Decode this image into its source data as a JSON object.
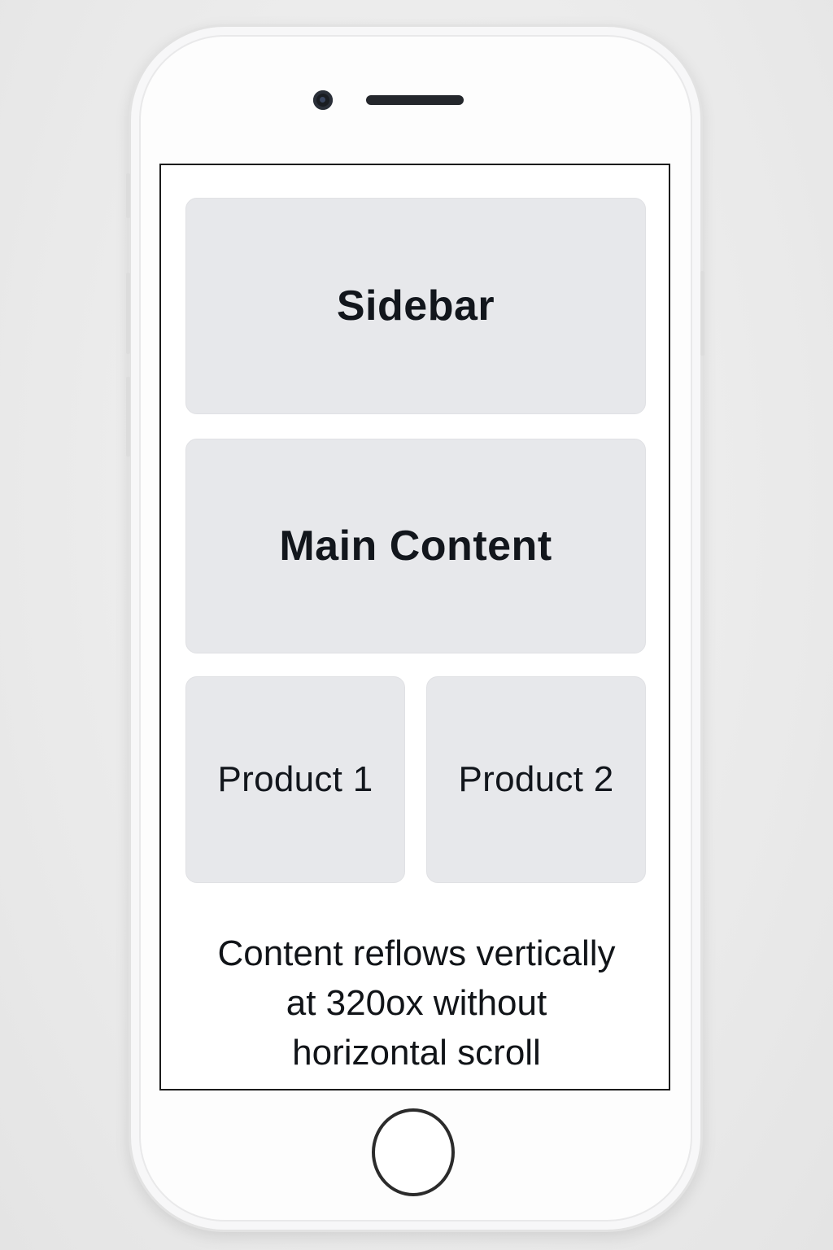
{
  "device": {
    "type": "smartphone",
    "colors": {
      "body": "#fdfdfd",
      "screen_border": "#1c1c1c",
      "card_bg": "#e7e8eb",
      "text": "#12161c"
    }
  },
  "screen": {
    "sidebar_label": "Sidebar",
    "main_content_label": "Main Content",
    "products": [
      {
        "label": "Product 1"
      },
      {
        "label": "Product 2"
      }
    ],
    "caption_lines": [
      "Content reflows vertically",
      "at 320ox without",
      "horizontal scroll"
    ]
  },
  "icons": {
    "camera": "front-camera-icon",
    "speaker": "earpiece-speaker-icon",
    "home": "home-button-icon"
  }
}
